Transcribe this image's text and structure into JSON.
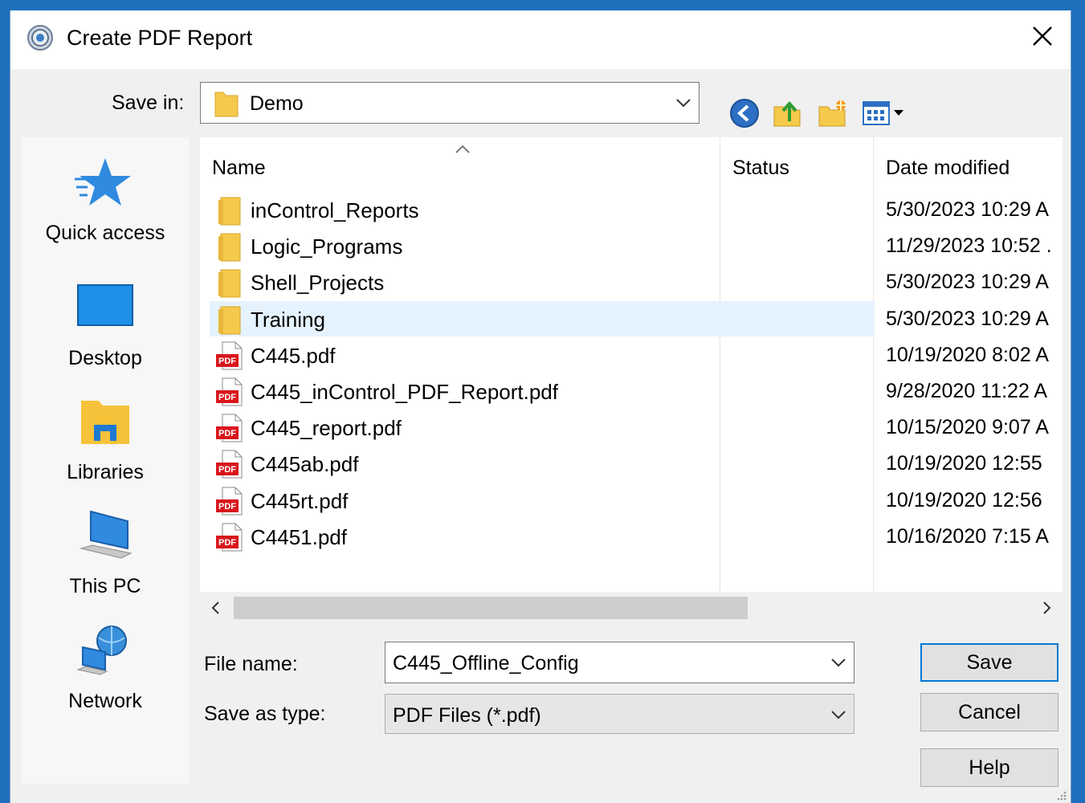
{
  "window": {
    "title": "Create PDF Report"
  },
  "toolbar": {
    "save_in_label": "Save in:",
    "save_in_value": "Demo",
    "icons": [
      "back-icon",
      "up-folder-icon",
      "new-folder-icon",
      "view-menu-icon"
    ]
  },
  "places": [
    {
      "label": "Quick access",
      "icon": "star-icon"
    },
    {
      "label": "Desktop",
      "icon": "desktop-icon"
    },
    {
      "label": "Libraries",
      "icon": "libraries-icon"
    },
    {
      "label": "This PC",
      "icon": "computer-icon"
    },
    {
      "label": "Network",
      "icon": "network-icon"
    }
  ],
  "file_list": {
    "columns": [
      "Name",
      "Status",
      "Date modified"
    ],
    "rows": [
      {
        "name": "inControl_Reports",
        "type": "folder",
        "date": "5/30/2023 10:29 A"
      },
      {
        "name": "Logic_Programs",
        "type": "folder",
        "date": "11/29/2023 10:52 ."
      },
      {
        "name": "Shell_Projects",
        "type": "folder",
        "date": "5/30/2023 10:29 A"
      },
      {
        "name": "Training",
        "type": "folder",
        "date": "5/30/2023 10:29 A",
        "selected": true
      },
      {
        "name": "C445.pdf",
        "type": "pdf",
        "date": "10/19/2020 8:02 A"
      },
      {
        "name": "C445_inControl_PDF_Report.pdf",
        "type": "pdf",
        "date": "9/28/2020 11:22 A"
      },
      {
        "name": "C445_report.pdf",
        "type": "pdf",
        "date": "10/15/2020 9:07 A"
      },
      {
        "name": "C445ab.pdf",
        "type": "pdf",
        "date": "10/19/2020 12:55"
      },
      {
        "name": "C445rt.pdf",
        "type": "pdf",
        "date": "10/19/2020 12:56"
      },
      {
        "name": "C4451.pdf",
        "type": "pdf",
        "date": "10/16/2020 7:15 A"
      }
    ]
  },
  "form": {
    "file_name_label": "File name:",
    "file_name_value": "C445_Offline_Config",
    "save_as_type_label": "Save as type:",
    "save_as_type_value": "PDF Files (*.pdf)"
  },
  "buttons": {
    "save": "Save",
    "cancel": "Cancel",
    "help": "Help"
  },
  "colors": {
    "accent": "#0078d7",
    "selection": "#e5f3ff",
    "folder": "#f5c94c",
    "pdf": "#d9161c"
  }
}
